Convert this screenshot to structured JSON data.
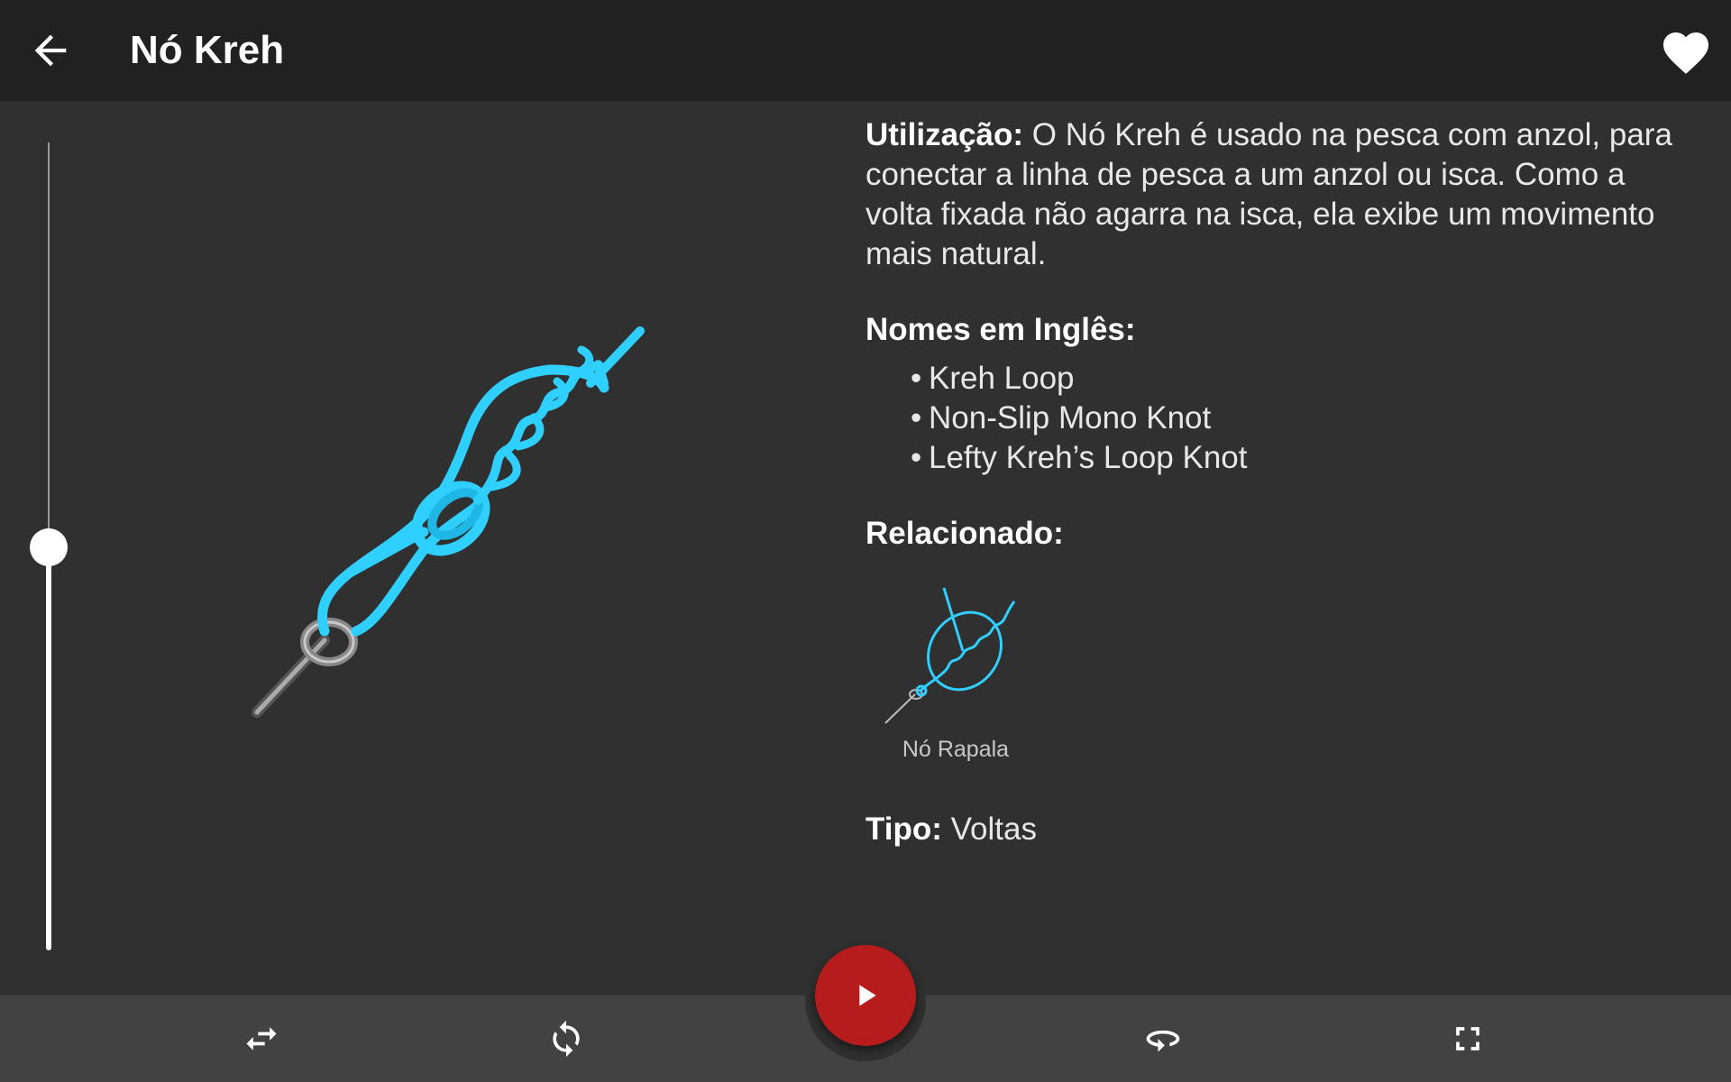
{
  "appbar": {
    "title": "Nó Kreh",
    "back_icon": "arrow-back-icon",
    "favorite_icon": "heart-icon"
  },
  "animation_slider": {
    "value": 0.5
  },
  "info": {
    "usage_label": "Utilização:",
    "usage_text": "O Nó Kreh é usado na pesca com anzol, para conectar a linha de pesca a um anzol ou isca. Como a volta fixada não agarra na isca, ela exibe um movimento mais natural.",
    "english_names_label": "Nomes em Inglês:",
    "english_names": [
      "Kreh Loop",
      "Non-Slip Mono Knot",
      "Lefty Kreh’s Loop Knot"
    ],
    "related_label": "Relacionado:",
    "related_items": [
      {
        "name": "Nó Rapala"
      }
    ],
    "type_label": "Tipo:",
    "type_value": "Voltas"
  },
  "bottom_bar": {
    "icons": [
      "swap-icon",
      "rotate-icon",
      "play-icon",
      "orbit-icon",
      "fullscreen-icon"
    ]
  },
  "colors": {
    "rope": "#2fd0ff",
    "play_button": "#b71c1c",
    "appbar": "#212121",
    "background": "#303030"
  }
}
